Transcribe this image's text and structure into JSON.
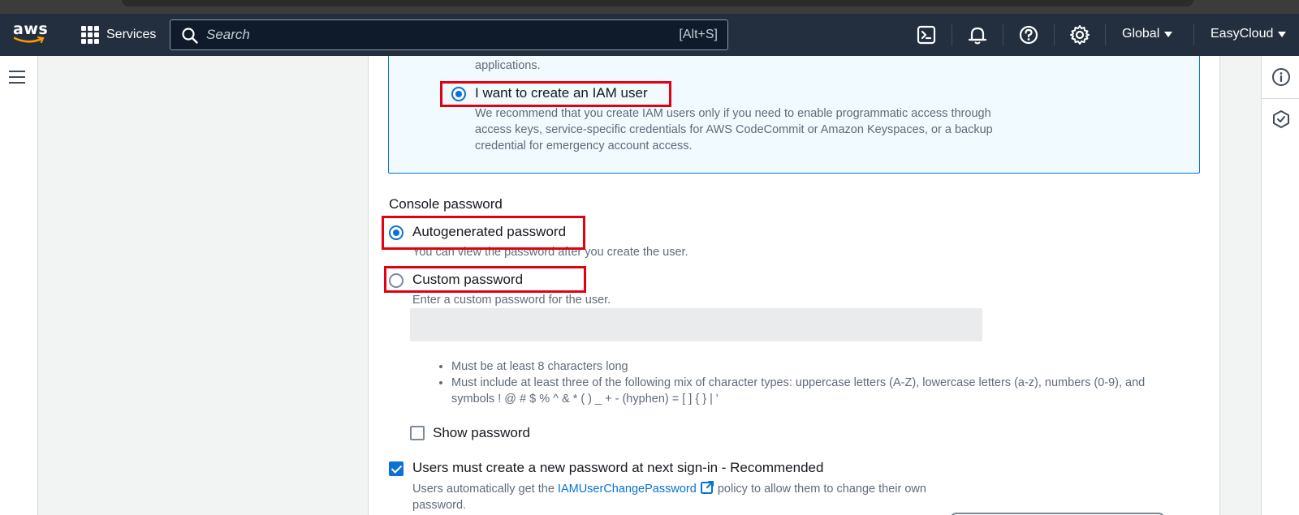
{
  "topnav": {
    "logo_text": "aws",
    "services_label": "Services",
    "search_placeholder": "Search",
    "search_shortcut": "[Alt+S]",
    "region_label": "Global",
    "account_label": "EasyCloud"
  },
  "page": {
    "prev_option_tail": "applications.",
    "iam_option_label": "I want to create an IAM user",
    "iam_option_desc": "We recommend that you create IAM users only if you need to enable programmatic access through access keys, service-specific credentials for AWS CodeCommit or Amazon Keyspaces, or a backup credential for emergency account access.",
    "console_password_heading": "Console password",
    "autogenerated_label": "Autogenerated password",
    "autogenerated_desc": "You can view the password after you create the user.",
    "custom_label": "Custom password",
    "custom_desc": "Enter a custom password for the user.",
    "custom_password_value": "",
    "requirements": [
      "Must be at least 8 characters long",
      "Must include at least three of the following mix of character types: uppercase letters (A-Z), lowercase letters (a-z), numbers (0-9), and symbols ! @ # $ % ^ & * ( ) _ + - (hyphen) = [ ] { } | '"
    ],
    "show_password_label": "Show password",
    "show_password_checked": false,
    "reset_label": "Users must create a new password at next sign-in - Recommended",
    "reset_checked": true,
    "reset_desc_prefix": "Users automatically get the",
    "reset_desc_link": "IAMUserChangePassword",
    "reset_desc_suffix": "policy to allow them to change their own password.",
    "iam_option_selected": true,
    "password_choice": "Autogenerated password"
  },
  "colors": {
    "nav_bg": "#232f3e",
    "accent": "#0972d3",
    "highlight": "#e3000f"
  }
}
